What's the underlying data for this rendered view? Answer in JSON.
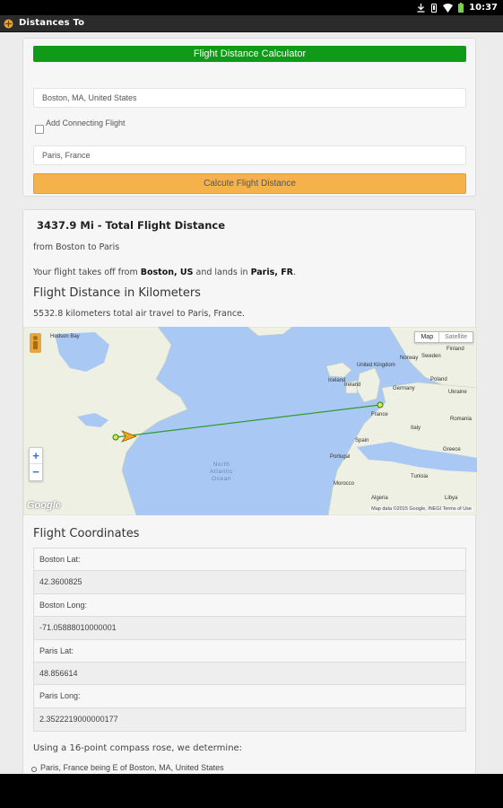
{
  "status_bar": {
    "time": "10:37",
    "icons": [
      "download-icon",
      "vibrate-icon",
      "wifi-icon",
      "battery-icon"
    ]
  },
  "app": {
    "title": "Distances To",
    "icon": "app-icon"
  },
  "form": {
    "header": "Flight Distance Calculator",
    "origin_value": "Boston, MA, United States",
    "connecting_label": "Add Connecting Flight",
    "connecting_checked": false,
    "destination_value": "Paris, France",
    "submit_label": "Calcute Flight Distance"
  },
  "results": {
    "total_value": "3437.9 Mi",
    "total_suffix": " - Total Flight Distance",
    "route": "from Boston to Paris",
    "takeoff": {
      "prefix": "Your flight takes off from ",
      "origin": "Boston, US",
      "middle": " and lands in ",
      "destination": "Paris, FR",
      "suffix": "."
    },
    "km_heading": "Flight Distance in Kilometers",
    "km_text": "5532.8 kilometers total air travel to Paris, France."
  },
  "map": {
    "type_options": [
      "Map",
      "Satellite"
    ],
    "selected_type": "Map",
    "ocean_label": [
      "North",
      "Atlantic",
      "Ocean"
    ],
    "labels": [
      "Hudson Bay",
      "Iceland",
      "Norway",
      "Sweden",
      "Finland",
      "Ireland",
      "United Kingdom",
      "Germany",
      "Poland",
      "Ukraine",
      "France",
      "Romania",
      "Italy",
      "Spain",
      "Portugal",
      "Greece",
      "Morocco",
      "Algeria",
      "Tunisia",
      "Libya"
    ],
    "zoom_in": "+",
    "zoom_out": "−",
    "logo": "Google",
    "attribution": "Map data ©2015 Google, INEGI   Terms of Use",
    "colors": {
      "water": "#a9c8f4",
      "land": "#eef0e4",
      "route": "#2f9c2f",
      "plane": "#f2a51f"
    }
  },
  "coordinates": {
    "heading": "Flight Coordinates",
    "rows": [
      "Boston Lat:",
      "42.3600825",
      "Boston Long:",
      "-71.05888010000001",
      "Paris Lat:",
      "48.856614",
      "Paris Long:",
      "2.3522219000000177"
    ]
  },
  "compass": {
    "intro": "Using a 16-point compass rose, we determine:",
    "items": [
      "Paris, France being E of Boston, MA, United States"
    ]
  },
  "colors": {
    "header_green": "#0f9a17",
    "button_orange": "#f5b14a",
    "action_bar": "#2b2b2b"
  }
}
